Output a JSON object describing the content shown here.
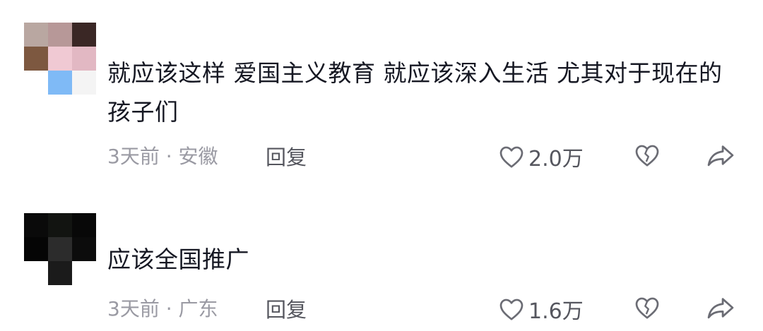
{
  "comments": [
    {
      "username": "",
      "text": "就应该这样 爱国主义教育 就应该深入生活 尤其对于现在的孩子们",
      "meta": "3天前 · 安徽",
      "reply_label": "回复",
      "likes": "2.0万",
      "icons": {
        "like": "heart-outline-icon",
        "dislike": "broken-heart-icon",
        "share": "share-arrow-icon"
      }
    },
    {
      "username": "",
      "text": "应该全国推广",
      "meta": "3天前 · 广东",
      "reply_label": "回复",
      "likes": "1.6万",
      "icons": {
        "like": "heart-outline-icon",
        "dislike": "broken-heart-icon",
        "share": "share-arrow-icon"
      }
    }
  ],
  "colors": {
    "text": "#161823",
    "meta": "#9a9aa3",
    "action": "#55565e",
    "background": "#ffffff"
  }
}
